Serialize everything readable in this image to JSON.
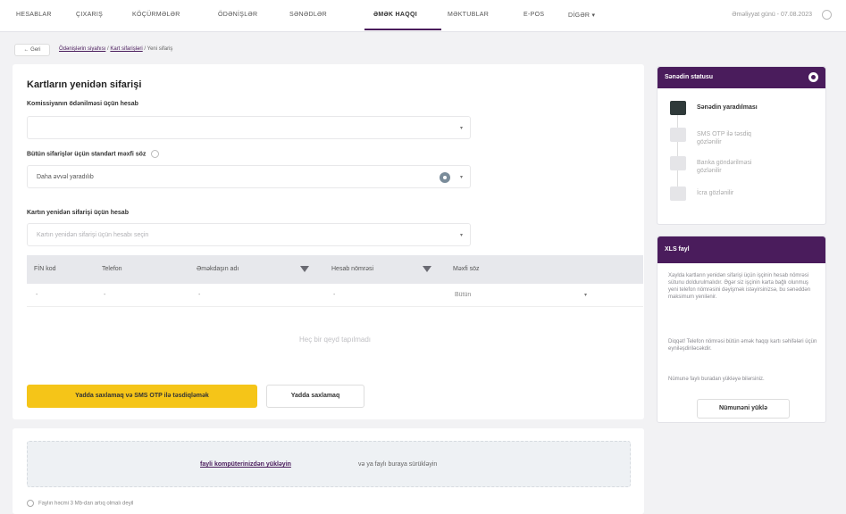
{
  "nav": {
    "items": [
      "HESABLAR",
      "ÇIXARIŞ",
      "KÖÇÜRMƏLƏR",
      "ÖDƏNİŞLƏR",
      "SƏNƏDLƏR",
      "ƏMƏK HAQQI",
      "MƏKTUBLAR",
      "E-POS",
      "DİGƏR ▾"
    ],
    "active": "ƏMƏK HAQQI",
    "date_text": "Əməliyyat günü - 07.08.2023"
  },
  "breadcrumb": {
    "back_label": "← Geri",
    "link1": "Ödənişlərin siyahısı",
    "link2": "Kart sifarişləri",
    "current": "Yeni sifariş"
  },
  "form": {
    "title": "Kartların yenidən sifarişi",
    "commission_label": "Komissiyanın ödənilməsi üçün hesab",
    "commission_value": "",
    "codeword_label": "Bütün sifarişlər üçün standart məxfi söz",
    "codeword_value": "Daha əvvəl yaradılıb",
    "reorder_label": "Kartın yenidən sifarişi üçün hesab",
    "reorder_placeholder": "Kartın yenidən sifarişi üçün hesabı seçin"
  },
  "table": {
    "columns": [
      "FİN kod",
      "Telefon",
      "Əməkdaşın adı",
      "Hesab nömrəsi",
      "Məxfi söz"
    ],
    "row": [
      "-",
      "-",
      "-",
      "-",
      "Bütün"
    ],
    "empty_message": "Heç bir qeyd tapılmadı"
  },
  "actions": {
    "primary": "Yadda saxlamaq və SMS OTP ilə təsdiqləmək",
    "secondary": "Yadda saxlamaq"
  },
  "upload": {
    "link": "fayli kompüterinizdən yükləyin",
    "text": "və ya faylı buraya sürükləyin",
    "note": "Faylın həcmi 3 Mb-dan artıq olmalı deyil"
  },
  "status_panel": {
    "title": "Sənədin statusu",
    "steps": [
      {
        "label": "Sənədin yaradılması",
        "done": true
      },
      {
        "label": "SMS OTP ilə təsdiq gözlənilir",
        "done": false
      },
      {
        "label": "Banka göndərilməsi gözlənilir",
        "done": false
      },
      {
        "label": "İcra gözlənilir",
        "done": false
      }
    ]
  },
  "xls_panel": {
    "title": "XLS fayl",
    "text1": "Xaylda kartların yenidən sifarişi üçün işçinin hesab nömrəsi sütunu doldurulmalıdır. Əgər siz işçinin karta bağlı olunmuş yeni telefon nömrəsini dəyişmək istəyirsinizsə, bu sənəddən maksimum yenilənir.",
    "text2": "Diqqət! Telefon nömrəsi bütün əmək haqqı kartı səhifələri üçün eyniləşdiriləcəkdir.",
    "text3": "Nümunə faylı buradan yükləyə bilərsiniz.",
    "button": "Nümunəni yüklə"
  },
  "colors": {
    "brand": "#4a1c5c",
    "accent": "#f5c518"
  }
}
